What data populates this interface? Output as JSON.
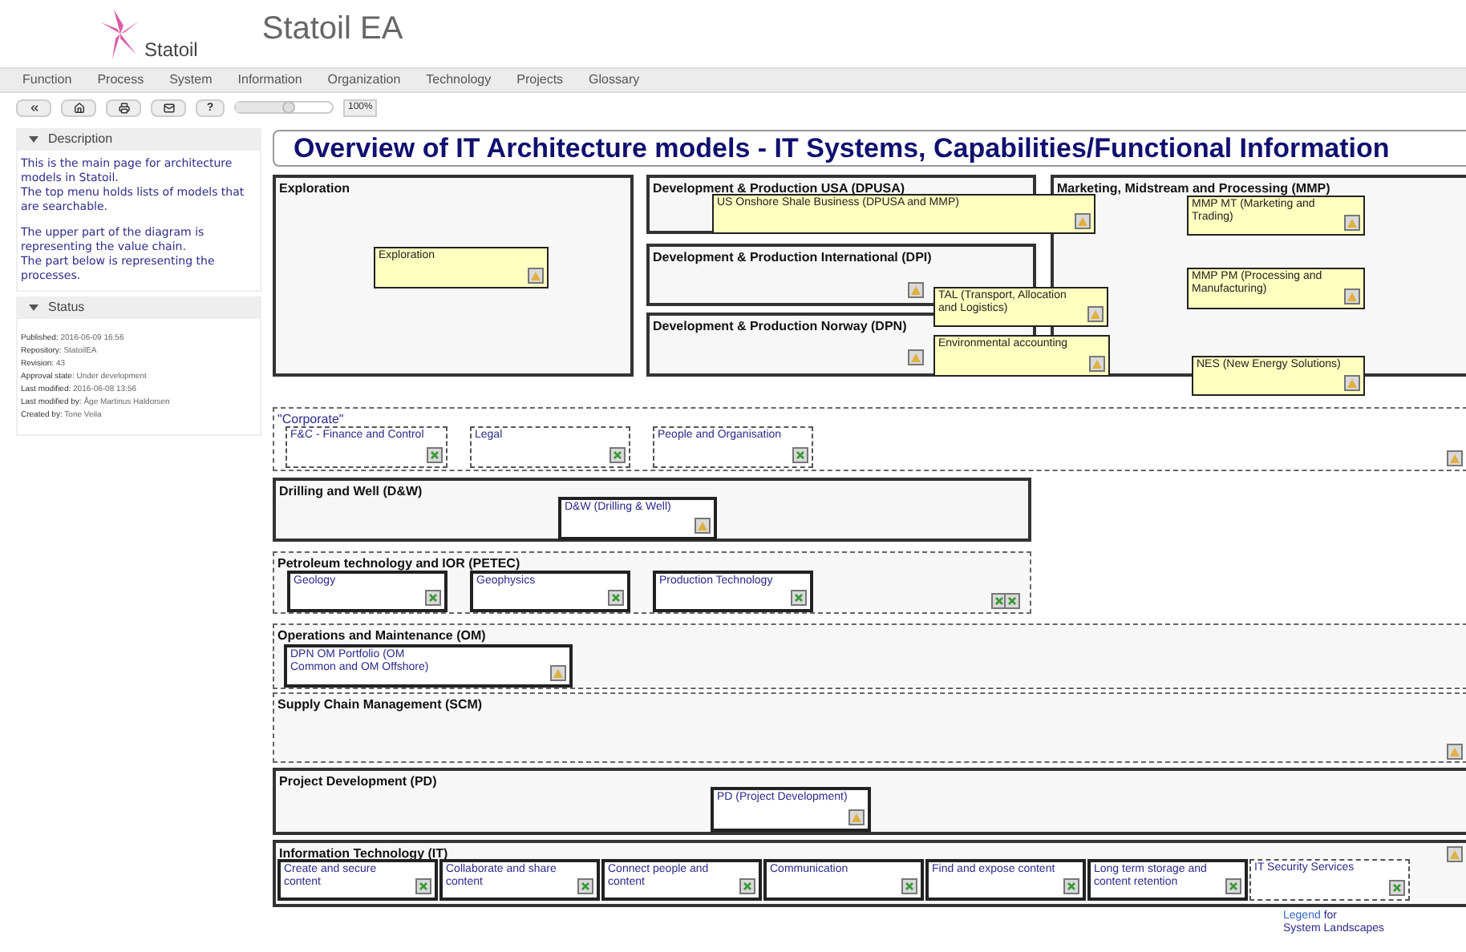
{
  "header": {
    "brand": "Statoil",
    "title": "Statoil EA"
  },
  "menu": [
    "Function",
    "Process",
    "System",
    "Information",
    "Organization",
    "Technology",
    "Projects",
    "Glossary"
  ],
  "toolbar": {
    "help": "?",
    "zoom": {
      "level": 0.55
    },
    "zoom_reading": "100%"
  },
  "sidebar": [
    {
      "kind": "text",
      "title": "Description",
      "expanded": true,
      "paragraphs": [
        "This is the main page for architecture models in Statoil.\nThe top menu holds lists of models that are searchable.",
        "The upper part of the diagram is representing the value chain.\nThe part below is representing the processes."
      ]
    },
    {
      "kind": "fields",
      "title": "Status",
      "expanded": true,
      "fields": [
        {
          "label": "Published:",
          "value": "2016-06-09 16:56"
        },
        {
          "label": "Repository:",
          "value": "StatoilEA"
        },
        {
          "label": "Revision:",
          "value": "43"
        },
        {
          "label": "Approval state:",
          "value": "Under development"
        },
        {
          "label": "Last modified:",
          "value": "2016-06-08 13:56"
        },
        {
          "label": "Last modified by:",
          "value": "Åge Martinus Haldorsen"
        },
        {
          "label": "Created by:",
          "value": "Tone Veila"
        }
      ]
    }
  ],
  "diagram": {
    "title": "Overview of IT Architecture models - IT Systems, Capabilities/Functional  Information",
    "groups": [
      {
        "name": "Exploration",
        "kind": "solid",
        "items": [
          {
            "text": "Exploration",
            "kind": "yellow"
          }
        ]
      },
      {
        "name": "Development & Production USA (DPUSA)",
        "kind": "solid",
        "items": [
          {
            "text": "US Onshore Shale Business (DPUSA and MMP)",
            "kind": "yellow"
          }
        ]
      },
      {
        "name": "Development & Production International (DPI)",
        "kind": "solid",
        "items": [
          {
            "text": "TAL (Transport, Allocation and Logistics)",
            "kind": "yellow"
          }
        ]
      },
      {
        "name": "Development & Production Norway (DPN)",
        "kind": "solid",
        "items": [
          {
            "text": "Environmental accounting",
            "kind": "yellow"
          }
        ]
      },
      {
        "name": "Marketing, Midstream and Processing (MMP)",
        "kind": "solid",
        "items": [
          {
            "text": "MMP MT (Marketing and Trading)",
            "kind": "yellow"
          },
          {
            "text": "MMP PM (Processing and Manufacturing)",
            "kind": "yellow"
          },
          {
            "text": "NES (New Energy Solutions)",
            "kind": "yellow"
          }
        ]
      },
      {
        "name": "\"Corporate\"",
        "kind": "informal",
        "items": [
          {
            "text": "F&C - Finance and Control",
            "kind": "dashed"
          },
          {
            "text": "Legal",
            "kind": "dashed"
          },
          {
            "text": "People and Organisation",
            "kind": "dashed"
          }
        ]
      },
      {
        "name": "Drilling and Well (D&W)",
        "kind": "solid",
        "items": [
          {
            "text": "D&W (Drilling & Well)",
            "kind": "linked"
          }
        ]
      },
      {
        "name": "Petroleum technology and IOR (PETEC)",
        "kind": "dashed",
        "items": [
          {
            "text": "Geology",
            "kind": "plain"
          },
          {
            "text": "Geophysics",
            "kind": "plain"
          },
          {
            "text": "Production Technology",
            "kind": "plain"
          }
        ]
      },
      {
        "name": "Operations and Maintenance (OM)",
        "kind": "dashed",
        "items": [
          {
            "text": "DPN OM Portfolio (OM\nCommon and OM Offshore)",
            "kind": "linked"
          }
        ]
      },
      {
        "name": "Supply Chain Management (SCM)",
        "kind": "dashed"
      },
      {
        "name": "Project Development (PD)",
        "kind": "solid",
        "items": [
          {
            "text": "PD (Project Development)",
            "kind": "linked"
          }
        ]
      },
      {
        "name": "Information Technology (IT)",
        "kind": "solid",
        "items": [
          {
            "text": "Create and secure content",
            "kind": "plain"
          },
          {
            "text": "Collaborate and share content",
            "kind": "plain"
          },
          {
            "text": "Connect people and content",
            "kind": "plain"
          },
          {
            "text": "Communication",
            "kind": "plain"
          },
          {
            "text": "Find and expose content",
            "kind": "plain"
          },
          {
            "text": "Long term storage and content retention",
            "kind": "plain"
          },
          {
            "text": "IT Security Services",
            "kind": "dashed"
          }
        ]
      }
    ],
    "legend": {
      "link": "Legend",
      "text": "for\nSystem Landscapes"
    }
  }
}
